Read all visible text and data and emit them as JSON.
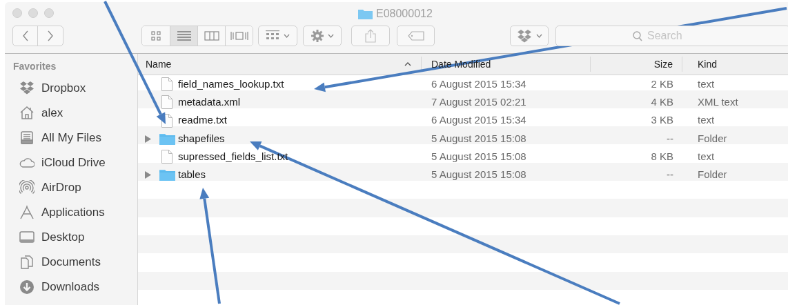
{
  "window": {
    "title": "E08000012"
  },
  "toolbar": {
    "view_modes": [
      {
        "kind": "icons",
        "selected": false
      },
      {
        "kind": "list",
        "selected": true
      },
      {
        "kind": "columns",
        "selected": false
      },
      {
        "kind": "cover_flow",
        "selected": false
      }
    ],
    "search": {
      "placeholder": "Search"
    }
  },
  "sidebar": {
    "heading": "Favorites",
    "items": [
      {
        "label": "Dropbox",
        "kind": "dropbox"
      },
      {
        "label": "alex",
        "kind": "home"
      },
      {
        "label": "All My Files",
        "kind": "files"
      },
      {
        "label": "iCloud Drive",
        "kind": "cloud"
      },
      {
        "label": "AirDrop",
        "kind": "airdrop"
      },
      {
        "label": "Applications",
        "kind": "apps"
      },
      {
        "label": "Desktop",
        "kind": "desktop"
      },
      {
        "label": "Documents",
        "kind": "documents"
      },
      {
        "label": "Downloads",
        "kind": "downloads"
      }
    ]
  },
  "table": {
    "columns": [
      {
        "label": "Name",
        "sorted": true
      },
      {
        "label": "Date Modified",
        "sorted": false
      },
      {
        "label": "Size",
        "sorted": false
      },
      {
        "label": "Kind",
        "sorted": false
      }
    ],
    "rows": [
      {
        "kind": "file",
        "name": "field_names_lookup.txt",
        "date_modified": "6 August 2015 15:34",
        "size": "2 KB",
        "file_kind": "text"
      },
      {
        "kind": "file",
        "name": "metadata.xml",
        "date_modified": "7 August 2015 02:21",
        "size": "4 KB",
        "file_kind": "XML text"
      },
      {
        "kind": "file",
        "name": "readme.txt",
        "date_modified": "6 August 2015 15:34",
        "size": "3 KB",
        "file_kind": "text"
      },
      {
        "kind": "folder",
        "name": "shapefiles",
        "date_modified": "5 August 2015 15:08",
        "size": "--",
        "file_kind": "Folder"
      },
      {
        "kind": "file",
        "name": "supressed_fields_list.txt",
        "date_modified": "5 August 2015 15:08",
        "size": "8 KB",
        "file_kind": "text"
      },
      {
        "kind": "folder",
        "name": "tables",
        "date_modified": "5 August 2015 15:08",
        "size": "--",
        "file_kind": "Folder"
      }
    ]
  }
}
